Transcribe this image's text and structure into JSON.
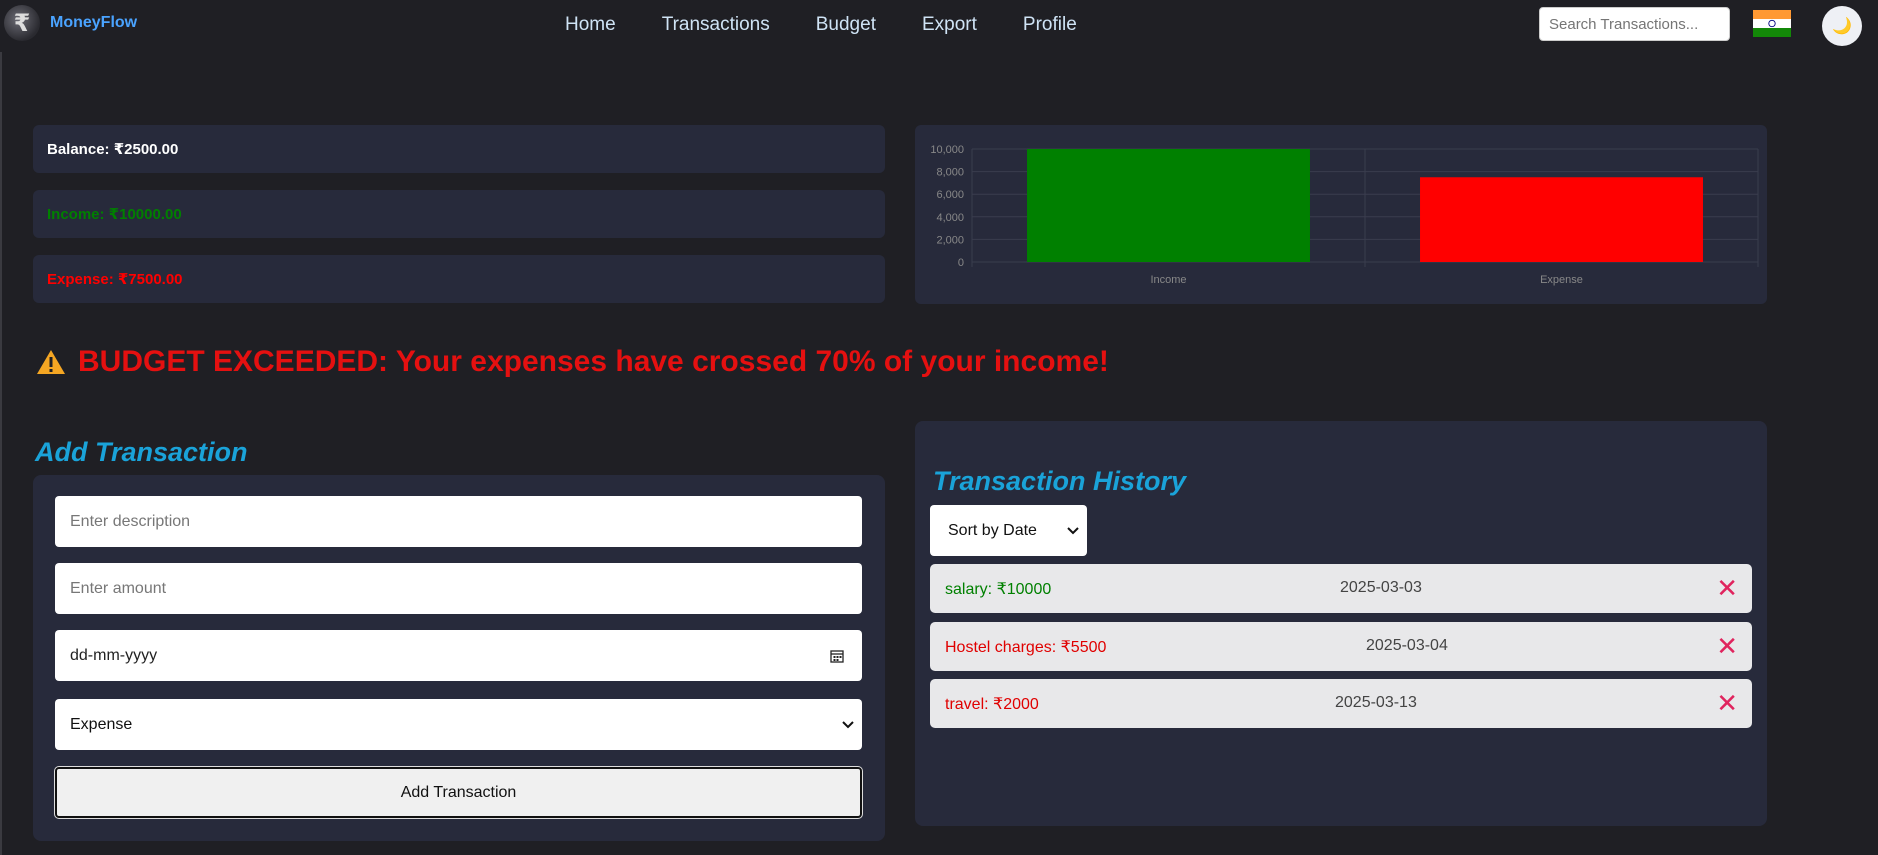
{
  "app": {
    "brand": "MoneyFlow"
  },
  "nav": {
    "links": [
      "Home",
      "Transactions",
      "Budget",
      "Export",
      "Profile"
    ]
  },
  "search": {
    "placeholder": "Search Transactions..."
  },
  "summary": {
    "balance": "Balance: ₹2500.00",
    "income": "Income: ₹10000.00",
    "expense": "Expense: ₹7500.00"
  },
  "colors": {
    "income": "#008000",
    "expense": "#ff0000",
    "accent": "#1aa3d9",
    "card": "#272a3b"
  },
  "chart_data": {
    "type": "bar",
    "categories": [
      "Income",
      "Expense"
    ],
    "values": [
      10000,
      7500
    ],
    "colors": [
      "#008000",
      "#ff0000"
    ],
    "ylim": [
      0,
      10000
    ],
    "yticks": [
      "10,000",
      "8,000",
      "6,000",
      "4,000",
      "2,000",
      "0"
    ],
    "grid": true
  },
  "alert": {
    "icon": "warning-icon",
    "text": "BUDGET EXCEEDED: Your expenses have crossed 70% of your income!"
  },
  "form": {
    "title": "Add Transaction",
    "description_placeholder": "Enter description",
    "amount_placeholder": "Enter amount",
    "date_placeholder": "dd-mm-yyyy",
    "type_value": "Expense",
    "submit_label": "Add Transaction"
  },
  "history": {
    "title": "Transaction History",
    "sort_label": "Sort by Date",
    "items": [
      {
        "desc": "salary: ₹10000",
        "date": "2025-03-03",
        "type": "income"
      },
      {
        "desc": "Hostel charges: ₹5500",
        "date": "2025-03-04",
        "type": "expense"
      },
      {
        "desc": "travel: ₹2000",
        "date": "2025-03-13",
        "type": "expense"
      }
    ]
  }
}
